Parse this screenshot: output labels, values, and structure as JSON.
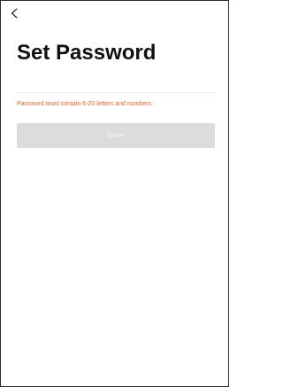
{
  "screen": {
    "title": "Set Password",
    "back_icon": "chevron-left-icon"
  },
  "form": {
    "password_value": "",
    "password_placeholder": "",
    "hint": "Password must contain 6-20 letters and numbers",
    "done_label": "Done",
    "done_enabled": false
  },
  "colors": {
    "hint": "#e8622b",
    "done_button_disabled": "#dcdcdc",
    "title": "#111111",
    "divider": "#ececec"
  }
}
